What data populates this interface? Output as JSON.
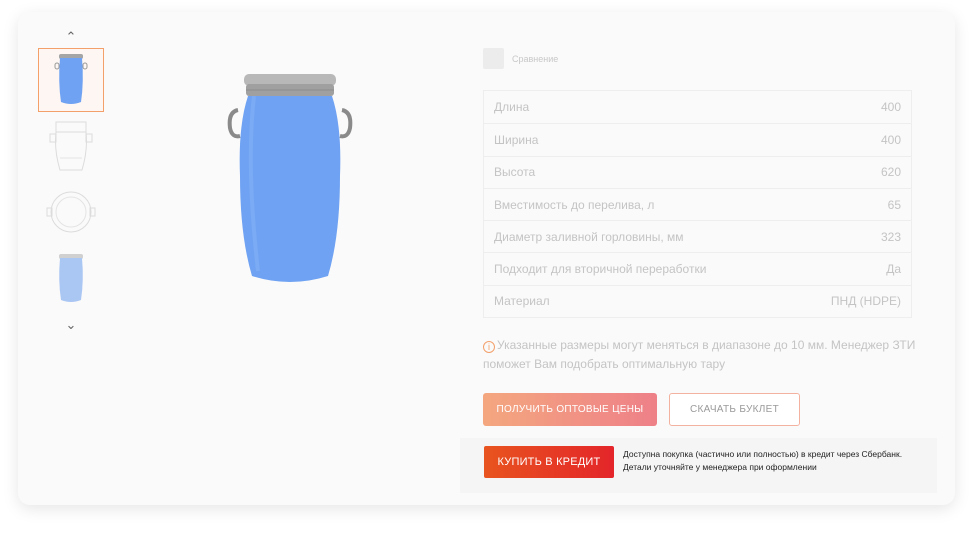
{
  "gallery": {
    "up_icon": "chevron-up-icon",
    "down_icon": "chevron-down-icon",
    "up_glyph": "⌃",
    "down_glyph": "⌄"
  },
  "compare": {
    "label": "Сравнение"
  },
  "specs": [
    {
      "label": "Длина",
      "value": "400"
    },
    {
      "label": "Ширина",
      "value": "400"
    },
    {
      "label": "Высота",
      "value": "620"
    },
    {
      "label": "Вместимость до перелива, л",
      "value": "65"
    },
    {
      "label": "Диаметр заливной горловины, мм",
      "value": "323"
    },
    {
      "label": "Подходит для вторичной переработки",
      "value": "Да"
    },
    {
      "label": "Материал",
      "value": "ПНД (HDPE)"
    }
  ],
  "note": {
    "icon": "info-icon",
    "text": "Указанные размеры могут меняться в диапазоне до 10 мм. Менеджер ЗТИ поможет Вам подобрать оптимальную тару"
  },
  "buttons": {
    "wholesale": "ПОЛУЧИТЬ ОПТОВЫЕ ЦЕНЫ",
    "booklet": "СКАЧАТЬ БУКЛЕТ",
    "credit": "КУПИТЬ В КРЕДИТ"
  },
  "credit_text": "Доступна покупка (частично или полностью) в кредит через Сбербанк. Детали уточняйте у менеджера при оформлении",
  "colors": {
    "accent": "#f3a06b",
    "barrel": "#6fa2f2",
    "lid": "#a5a5a5",
    "credit": "#e4252a"
  }
}
